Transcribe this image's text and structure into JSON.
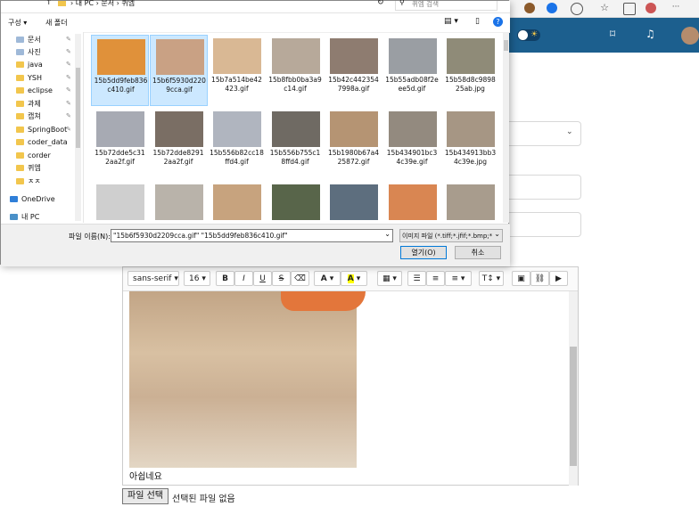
{
  "browser": {
    "search_placeholder": "퀴엠 검색"
  },
  "dialog": {
    "breadcrumb": [
      "내 PC",
      "문서",
      "퀴엠"
    ],
    "organize_label": "구성",
    "new_folder_label": "새 폴더",
    "nav_items": [
      {
        "label": "문서",
        "icon": "document-icon",
        "pinned": true
      },
      {
        "label": "사진",
        "icon": "pictures-icon",
        "pinned": true
      },
      {
        "label": "java",
        "icon": "folder-icon",
        "pinned": true
      },
      {
        "label": "YSH",
        "icon": "folder-icon",
        "pinned": true
      },
      {
        "label": "eclipse",
        "icon": "folder-icon",
        "pinned": true
      },
      {
        "label": "과제",
        "icon": "folder-icon",
        "pinned": true
      },
      {
        "label": "캡쳐",
        "icon": "folder-icon",
        "pinned": true
      },
      {
        "label": "SpringBoot",
        "icon": "folder-icon",
        "pinned": true
      },
      {
        "label": "coder_data",
        "icon": "folder-icon",
        "pinned": false
      },
      {
        "label": "corder",
        "icon": "folder-icon",
        "pinned": false
      },
      {
        "label": "퀴엠",
        "icon": "folder-icon",
        "pinned": false
      },
      {
        "label": "ㅈㅈ",
        "icon": "folder-icon",
        "pinned": false
      },
      {
        "label": "OneDrive",
        "icon": "cloud-icon",
        "pinned": false
      },
      {
        "label": "내 PC",
        "icon": "pc-icon",
        "pinned": false
      }
    ],
    "files": [
      {
        "name": "15b5dd9feb836c410.gif",
        "selected": true,
        "color": "#e0913a"
      },
      {
        "name": "15b6f5930d2209cca.gif",
        "selected": true,
        "color": "#c9a184"
      },
      {
        "name": "15b7a514be42423.gif",
        "selected": false,
        "color": "#d9b894"
      },
      {
        "name": "15b8fbb0ba3a9c14.gif",
        "selected": false,
        "color": "#b7a99a"
      },
      {
        "name": "15b42c4423547998a.gif",
        "selected": false,
        "color": "#8e7c70"
      },
      {
        "name": "15b55adb08f2eee5d.gif",
        "selected": false,
        "color": "#9a9ea3"
      },
      {
        "name": "15b58d8c989825ab.jpg",
        "selected": false,
        "color": "#8f8b78"
      },
      {
        "name": "15b72dde5c312aa2f.gif",
        "selected": false,
        "color": "#a7aab3"
      },
      {
        "name": "15b72dde82912aa2f.gif",
        "selected": false,
        "color": "#7a6e64"
      },
      {
        "name": "15b556b82cc18ffd4.gif",
        "selected": false,
        "color": "#b0b5bf"
      },
      {
        "name": "15b556b755c18ffd4.gif",
        "selected": false,
        "color": "#6f6a63"
      },
      {
        "name": "15b1980b67a425872.gif",
        "selected": false,
        "color": "#b59473"
      },
      {
        "name": "15b434901bc34c39e.gif",
        "selected": false,
        "color": "#938a7f"
      },
      {
        "name": "15b434913bb34c39e.jpg",
        "selected": false,
        "color": "#a69684"
      },
      {
        "name": "",
        "selected": false,
        "color": "#cfcfcf"
      },
      {
        "name": "",
        "selected": false,
        "color": "#b9b3aa"
      },
      {
        "name": "",
        "selected": false,
        "color": "#c7a37e"
      },
      {
        "name": "",
        "selected": false,
        "color": "#58654a"
      },
      {
        "name": "",
        "selected": false,
        "color": "#5d6e7e"
      },
      {
        "name": "",
        "selected": false,
        "color": "#d98652"
      },
      {
        "name": "",
        "selected": false,
        "color": "#a89c8d"
      }
    ],
    "filename_label": "파일 이름(N):",
    "filename_value": "\"15b6f5930d2209cca.gif\" \"15b5dd9feb836c410.gif\"",
    "filetype_value": "이미지 파일 (*.tiff;*.jfif;*.bmp;*",
    "open_label": "열기(O)",
    "cancel_label": "취소"
  },
  "editor": {
    "font_family": "sans-serif",
    "font_size": "16",
    "caption": "아쉽네요"
  },
  "file_input": {
    "button_label": "파일 선택",
    "status_text": "선택된 파일 없음"
  },
  "colors": {
    "header": "#1c5f8e",
    "selection": "#cce8ff"
  }
}
